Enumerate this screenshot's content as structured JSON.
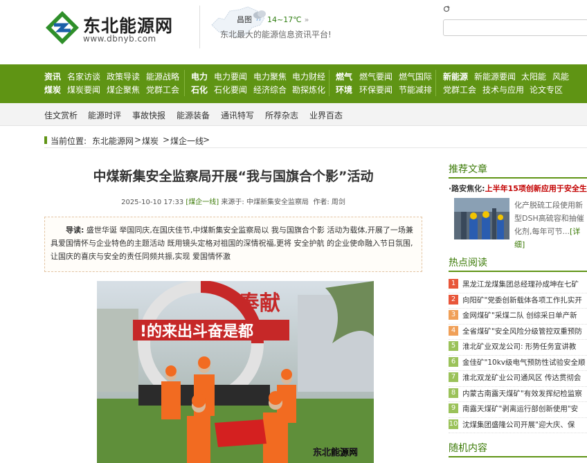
{
  "site": {
    "logo_name": "东北能源网",
    "logo_url": "www.dbnyb.com",
    "weather_city": "昌图",
    "weather_temp": "14~17℃",
    "weather_arrow": "»",
    "slogan": "东北最大的能源信息资讯平台!"
  },
  "nav_row1": [
    "资讯",
    "名家访谈",
    "政策导读",
    "能源战略",
    "电力",
    "电力要闻",
    "电力聚焦",
    "电力财经",
    "燃气",
    "燃气要闻",
    "燃气国际",
    "新能源",
    "新能源要闻",
    "太阳能",
    "风能"
  ],
  "nav_row2": [
    "煤炭",
    "煤炭要闻",
    "煤企聚焦",
    "党群工会",
    "石化",
    "石化要闻",
    "经济综合",
    "勘探炼化",
    "环境",
    "环保要闻",
    "节能减排",
    "党群工会",
    "技术与应用",
    "论文专区"
  ],
  "subnav": [
    "佳文赏析",
    "能源时评",
    "事故快报",
    "能源装备",
    "通讯特写",
    "所荐杂志",
    "业界百态"
  ],
  "breadcrumb": {
    "label": "当前位置:",
    "home": "东北能源网",
    "sep1": ">",
    "cat": "煤炭",
    "sep2": ">",
    "sub": "煤企一线",
    "sep3": ">"
  },
  "article": {
    "title": "中煤新集安全监察局开展“我与国旗合个影”活动",
    "datetime": "2025-10-10 17:33",
    "tag": "[煤企一线]",
    "source_label": "来源于:",
    "source": "中煤新集安全监察局",
    "author_label": "作者:",
    "author": "周剑",
    "summary_lead": "导读:",
    "summary": "盛世华诞 举国同庆,在国庆佳节,中煤新集安全监察局以 我与国旗合个影 活动为载体,开展了一场兼具爱国情怀与企业特色的主题活动 既用镜头定格对祖国的深情祝福,更将 安全护航 的企业使命融入节日氛围,让国庆的喜庆与安全的责任同频共振,实现 爱国情怀激",
    "photo_sign_top": "奉献",
    "photo_sign_main": "!的来出斗奋是都",
    "photo_watermark": "东北能源网"
  },
  "sidebar": {
    "recommend_heading": "推荐文章",
    "rec_title_prefix": "·路安焦化:",
    "rec_title": "上半年15项创新应用于安全生",
    "rec_desc": "化产脱硫工段使用新型DSH高硫容和抽催化剂,每年可节...",
    "rec_more": "[详细]",
    "hot_heading": "热点阅读",
    "hot_items": [
      {
        "num": "1",
        "text": "黑龙江龙煤集团总经理孙成坤在七矿"
      },
      {
        "num": "2",
        "text": "向阳矿\"党委创新载体各项工作扎实开"
      },
      {
        "num": "3",
        "text": "金网煤矿\"采煤二队 创综采日单产新"
      },
      {
        "num": "4",
        "text": "全省煤矿\"安全风险分级管控双重预防"
      },
      {
        "num": "5",
        "text": "淮北矿业双龙公司: 形势任务宣讲教"
      },
      {
        "num": "6",
        "text": "金佳矿\"10kv级电气预防性试验安全顺"
      },
      {
        "num": "7",
        "text": "淮北双龙矿业公司通风区 传达贯彻会"
      },
      {
        "num": "8",
        "text": "内蒙古南露天煤矿\"有效发挥纪检监察"
      },
      {
        "num": "9",
        "text": "南露天煤矿\"剥离运行部创新使用\"安"
      },
      {
        "num": "10",
        "text": "沈煤集团盛隆公司开展\"迎大庆、保"
      }
    ],
    "random_heading": "随机内容"
  },
  "colors": {
    "brand_green": "#5f9414",
    "accent_red": "#c30000"
  }
}
